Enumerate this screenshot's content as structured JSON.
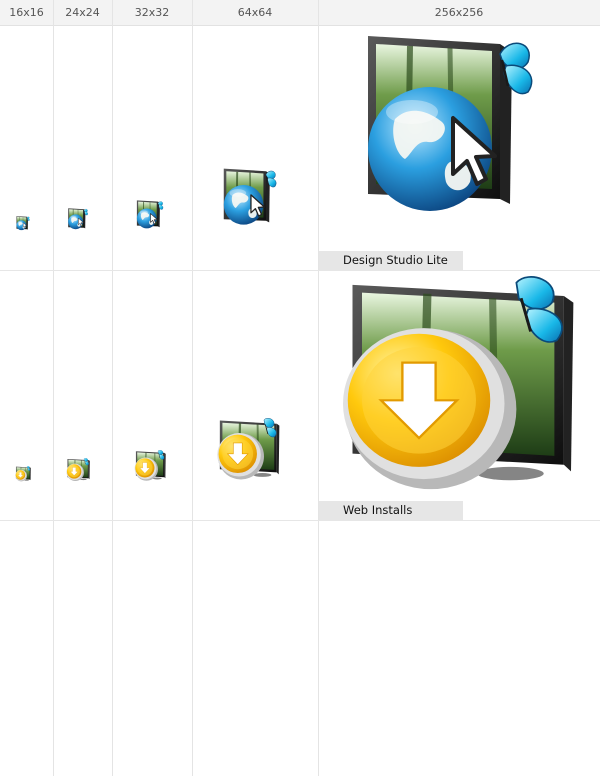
{
  "columns": [
    {
      "key": "c16",
      "label": "16x16"
    },
    {
      "key": "c24",
      "label": "24x24"
    },
    {
      "key": "c32",
      "label": "32x32"
    },
    {
      "key": "c64",
      "label": "64x64"
    },
    {
      "key": "c256",
      "label": "256x256"
    }
  ],
  "rows": [
    {
      "name": "Design Studio Lite",
      "icon": "globe-cursor-monitor-icon"
    },
    {
      "name": "Web Installs",
      "icon": "download-button-monitor-icon"
    }
  ]
}
